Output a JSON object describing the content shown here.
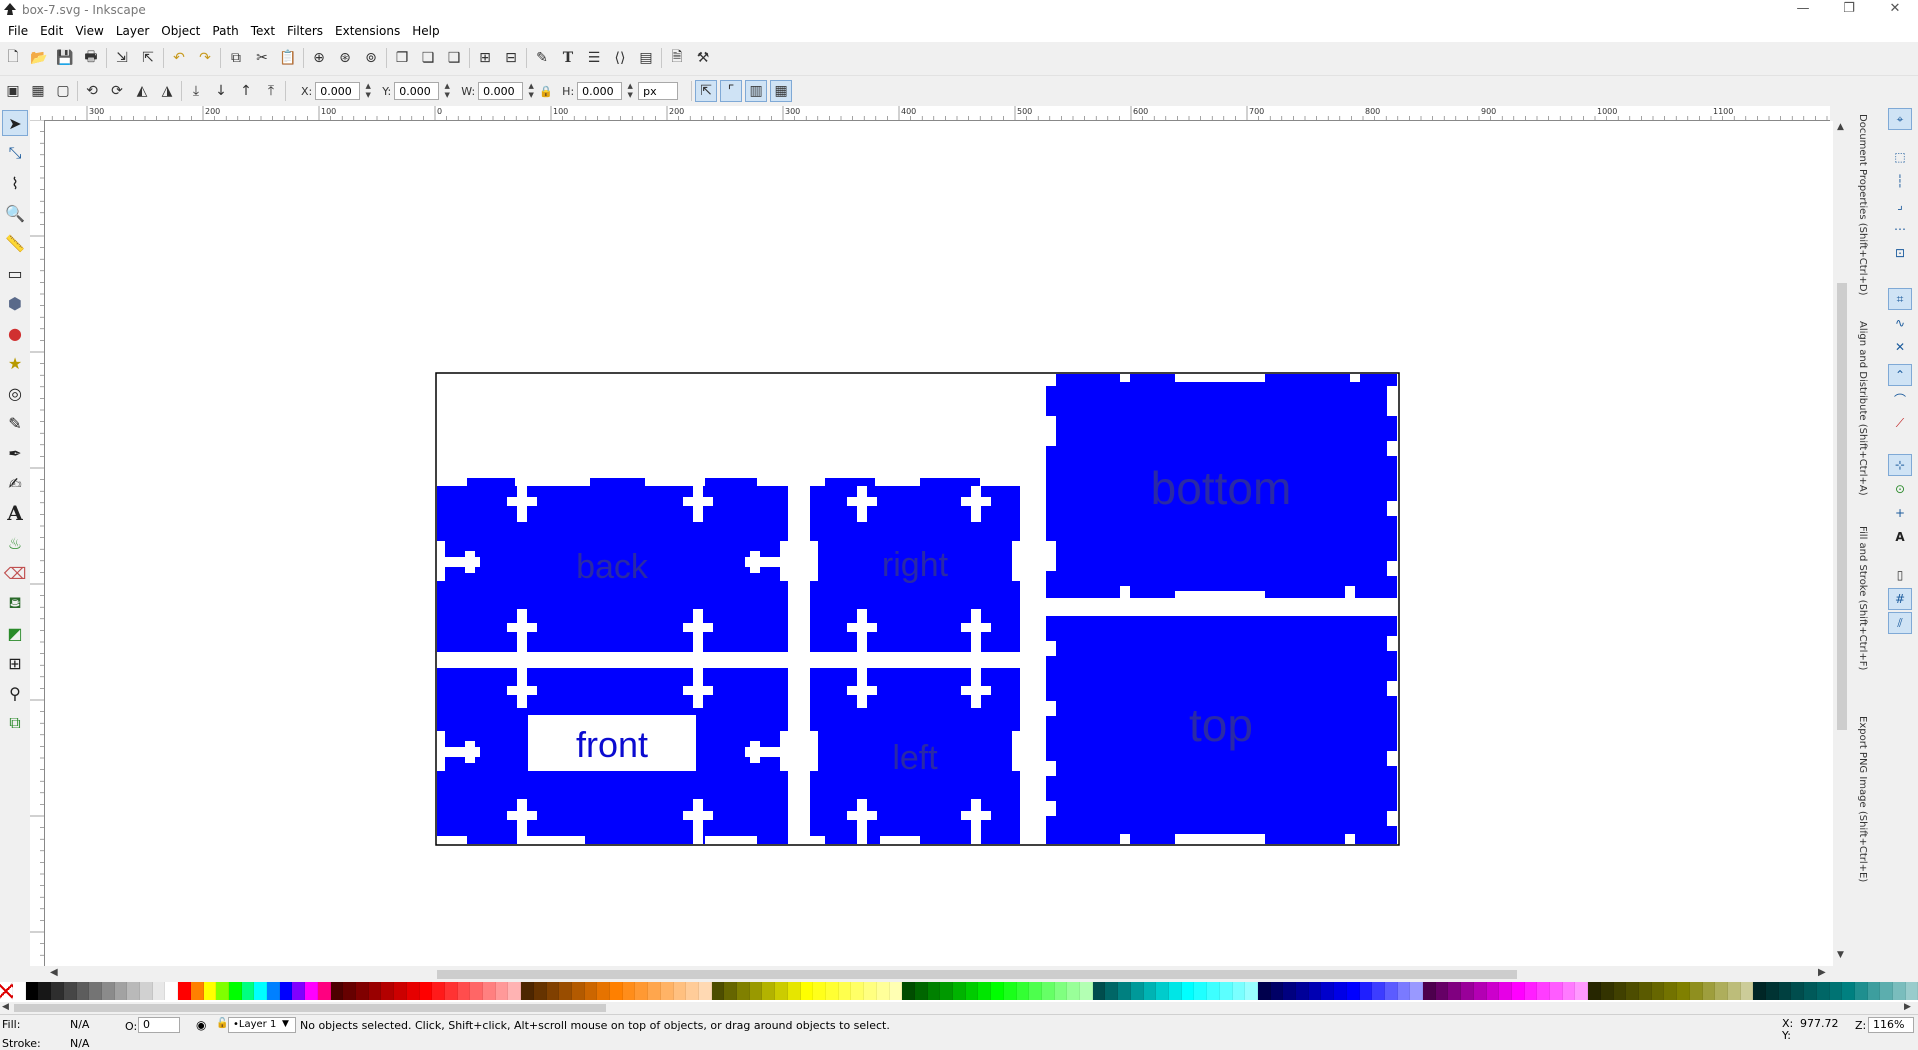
{
  "window": {
    "title": "box-7.svg - Inkscape",
    "minimize": "—",
    "restore": "❐",
    "close": "✕"
  },
  "menus": [
    "File",
    "Edit",
    "View",
    "Layer",
    "Object",
    "Path",
    "Text",
    "Filters",
    "Extensions",
    "Help"
  ],
  "controls": {
    "x_label": "X:",
    "x_value": "0.000",
    "y_label": "Y:",
    "y_value": "0.000",
    "w_label": "W:",
    "w_value": "0.000",
    "h_label": "H:",
    "h_value": "0.000",
    "unit": "px"
  },
  "ruler_labels": [
    "300",
    "200",
    "100",
    "0",
    "100",
    "200",
    "300",
    "400",
    "500",
    "600",
    "700",
    "800",
    "900",
    "1000",
    "1100"
  ],
  "canvas": {
    "back_label": "back",
    "right_label": "right",
    "bottom_label": "bottom",
    "front_label": "front",
    "left_label": "left",
    "top_label": "top"
  },
  "colors": {
    "panel_fill": "#0000ff",
    "label_color": "#2a2aa5",
    "front_label_color": "#0b0bd0",
    "page_border": "#000000"
  },
  "dock_tabs": [
    "Document Properties (Shift+Ctrl+D)",
    "Align and Distribute (Shift+Ctrl+A)",
    "Fill and Stroke (Shift+Ctrl+F)",
    "Export PNG Image (Shift+Ctrl+E)"
  ],
  "statusbar": {
    "fill_label": "Fill:",
    "fill_value": "N/A",
    "stroke_label": "Stroke:",
    "stroke_value": "N/A",
    "opacity_label": "O:",
    "opacity_value": "0",
    "layer": "•Layer 1",
    "message": "No objects selected. Click, Shift+click, Alt+scroll mouse on top of objects, or drag around objects to select.",
    "cursor_x_label": "X:",
    "cursor_x": "977.72",
    "cursor_y_label": "Y:",
    "cursor_y": "",
    "zoom_label": "Z:",
    "zoom": "116%"
  },
  "icons": {
    "logo": "inkscape-logo-icon",
    "selector": "selector-arrow-icon",
    "node": "node-edit-icon",
    "tweak": "tweak-icon",
    "zoom": "zoom-icon",
    "measure": "measure-icon",
    "rect": "rectangle-icon",
    "box3d": "3d-box-icon",
    "circle": "ellipse-icon",
    "star": "star-icon",
    "spiral": "spiral-icon",
    "pencil": "pencil-icon",
    "pen": "bezier-pen-icon",
    "calligraphy": "calligraphy-icon",
    "text": "text-icon",
    "spray": "spray-icon",
    "eraser": "eraser-icon",
    "bucket": "paint-bucket-icon",
    "gradient": "gradient-icon",
    "mesh": "mesh-icon",
    "dropper": "dropper-icon",
    "connector": "connector-icon"
  }
}
